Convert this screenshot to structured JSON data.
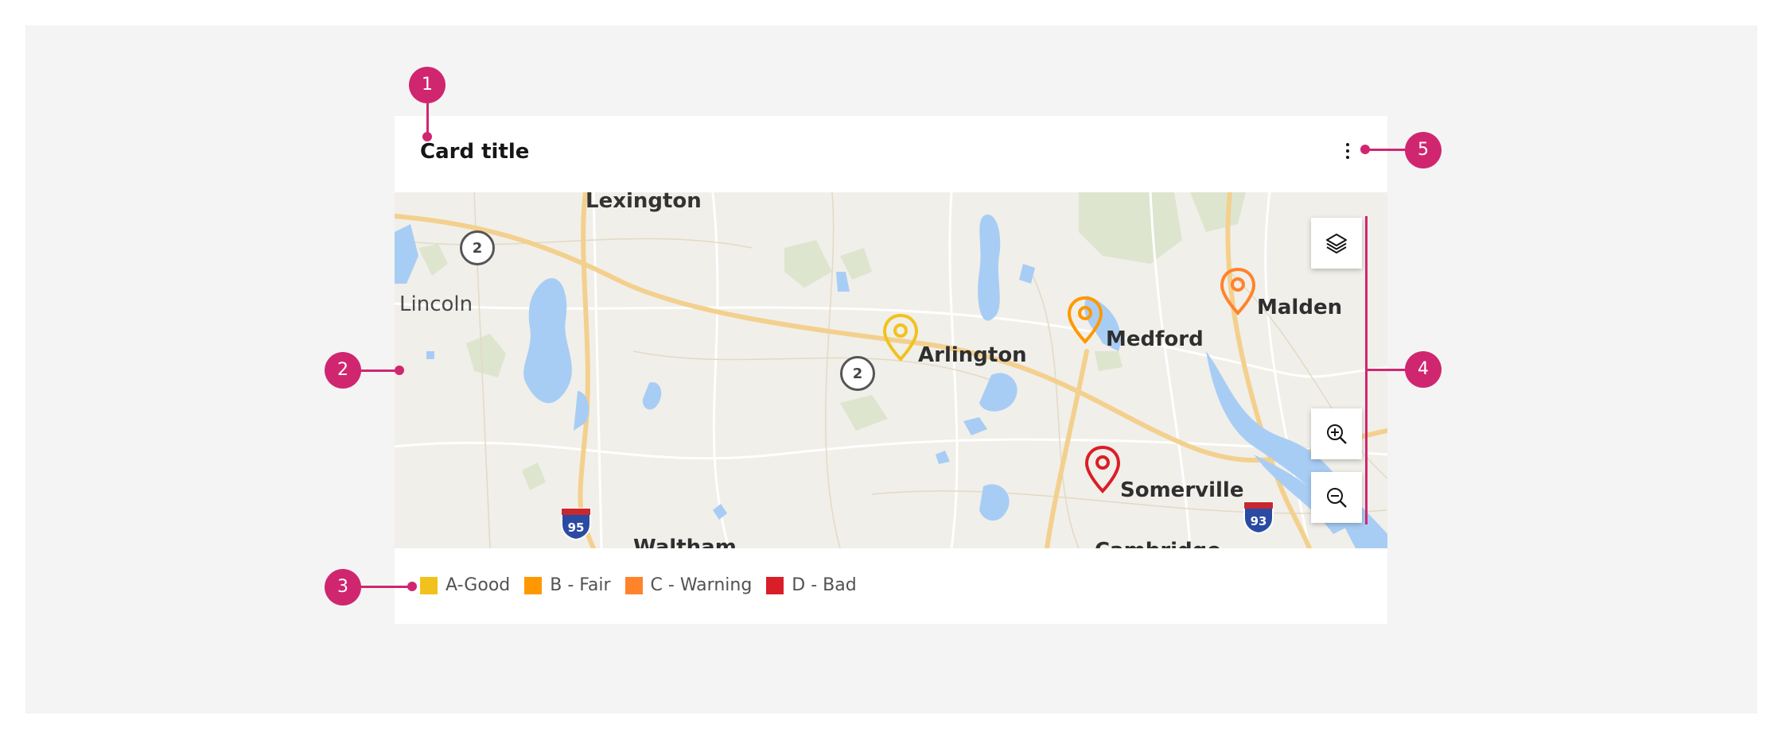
{
  "card": {
    "title": "Card title",
    "overflow_menu_icon": "overflow-menu-vertical-icon"
  },
  "map": {
    "places": [
      {
        "name": "Lexington"
      },
      {
        "name": "Lincoln"
      },
      {
        "name": "Arlington"
      },
      {
        "name": "Medford"
      },
      {
        "name": "Malden"
      },
      {
        "name": "Somerville"
      },
      {
        "name": "Waltham"
      },
      {
        "name": "Cambridge"
      }
    ],
    "routes": [
      "2",
      "2"
    ],
    "interstates": [
      "95",
      "93"
    ],
    "pins": [
      {
        "place": "Arlington",
        "status": "A-Good",
        "color": "#f1c21b"
      },
      {
        "place": "Medford",
        "status": "B - Fair",
        "color": "#ff9800"
      },
      {
        "place": "Malden",
        "status": "C - Warning",
        "color": "#ff832b"
      },
      {
        "place": "Somerville",
        "status": "D - Bad",
        "color": "#da1e28"
      }
    ],
    "controls": {
      "layers_icon": "layers-icon",
      "zoom_in_icon": "zoom-in-icon",
      "zoom_out_icon": "zoom-out-icon"
    }
  },
  "legend": [
    {
      "label": "A-Good",
      "color": "#f1c21b"
    },
    {
      "label": "B - Fair",
      "color": "#ff9800"
    },
    {
      "label": "C - Warning",
      "color": "#ff832b"
    },
    {
      "label": "D - Bad",
      "color": "#da1e28"
    }
  ],
  "callouts": [
    "1",
    "2",
    "3",
    "4",
    "5"
  ],
  "colors": {
    "callout": "#d02670",
    "background": "#f4f4f4",
    "card": "#ffffff",
    "water": "#a8cdf5"
  }
}
